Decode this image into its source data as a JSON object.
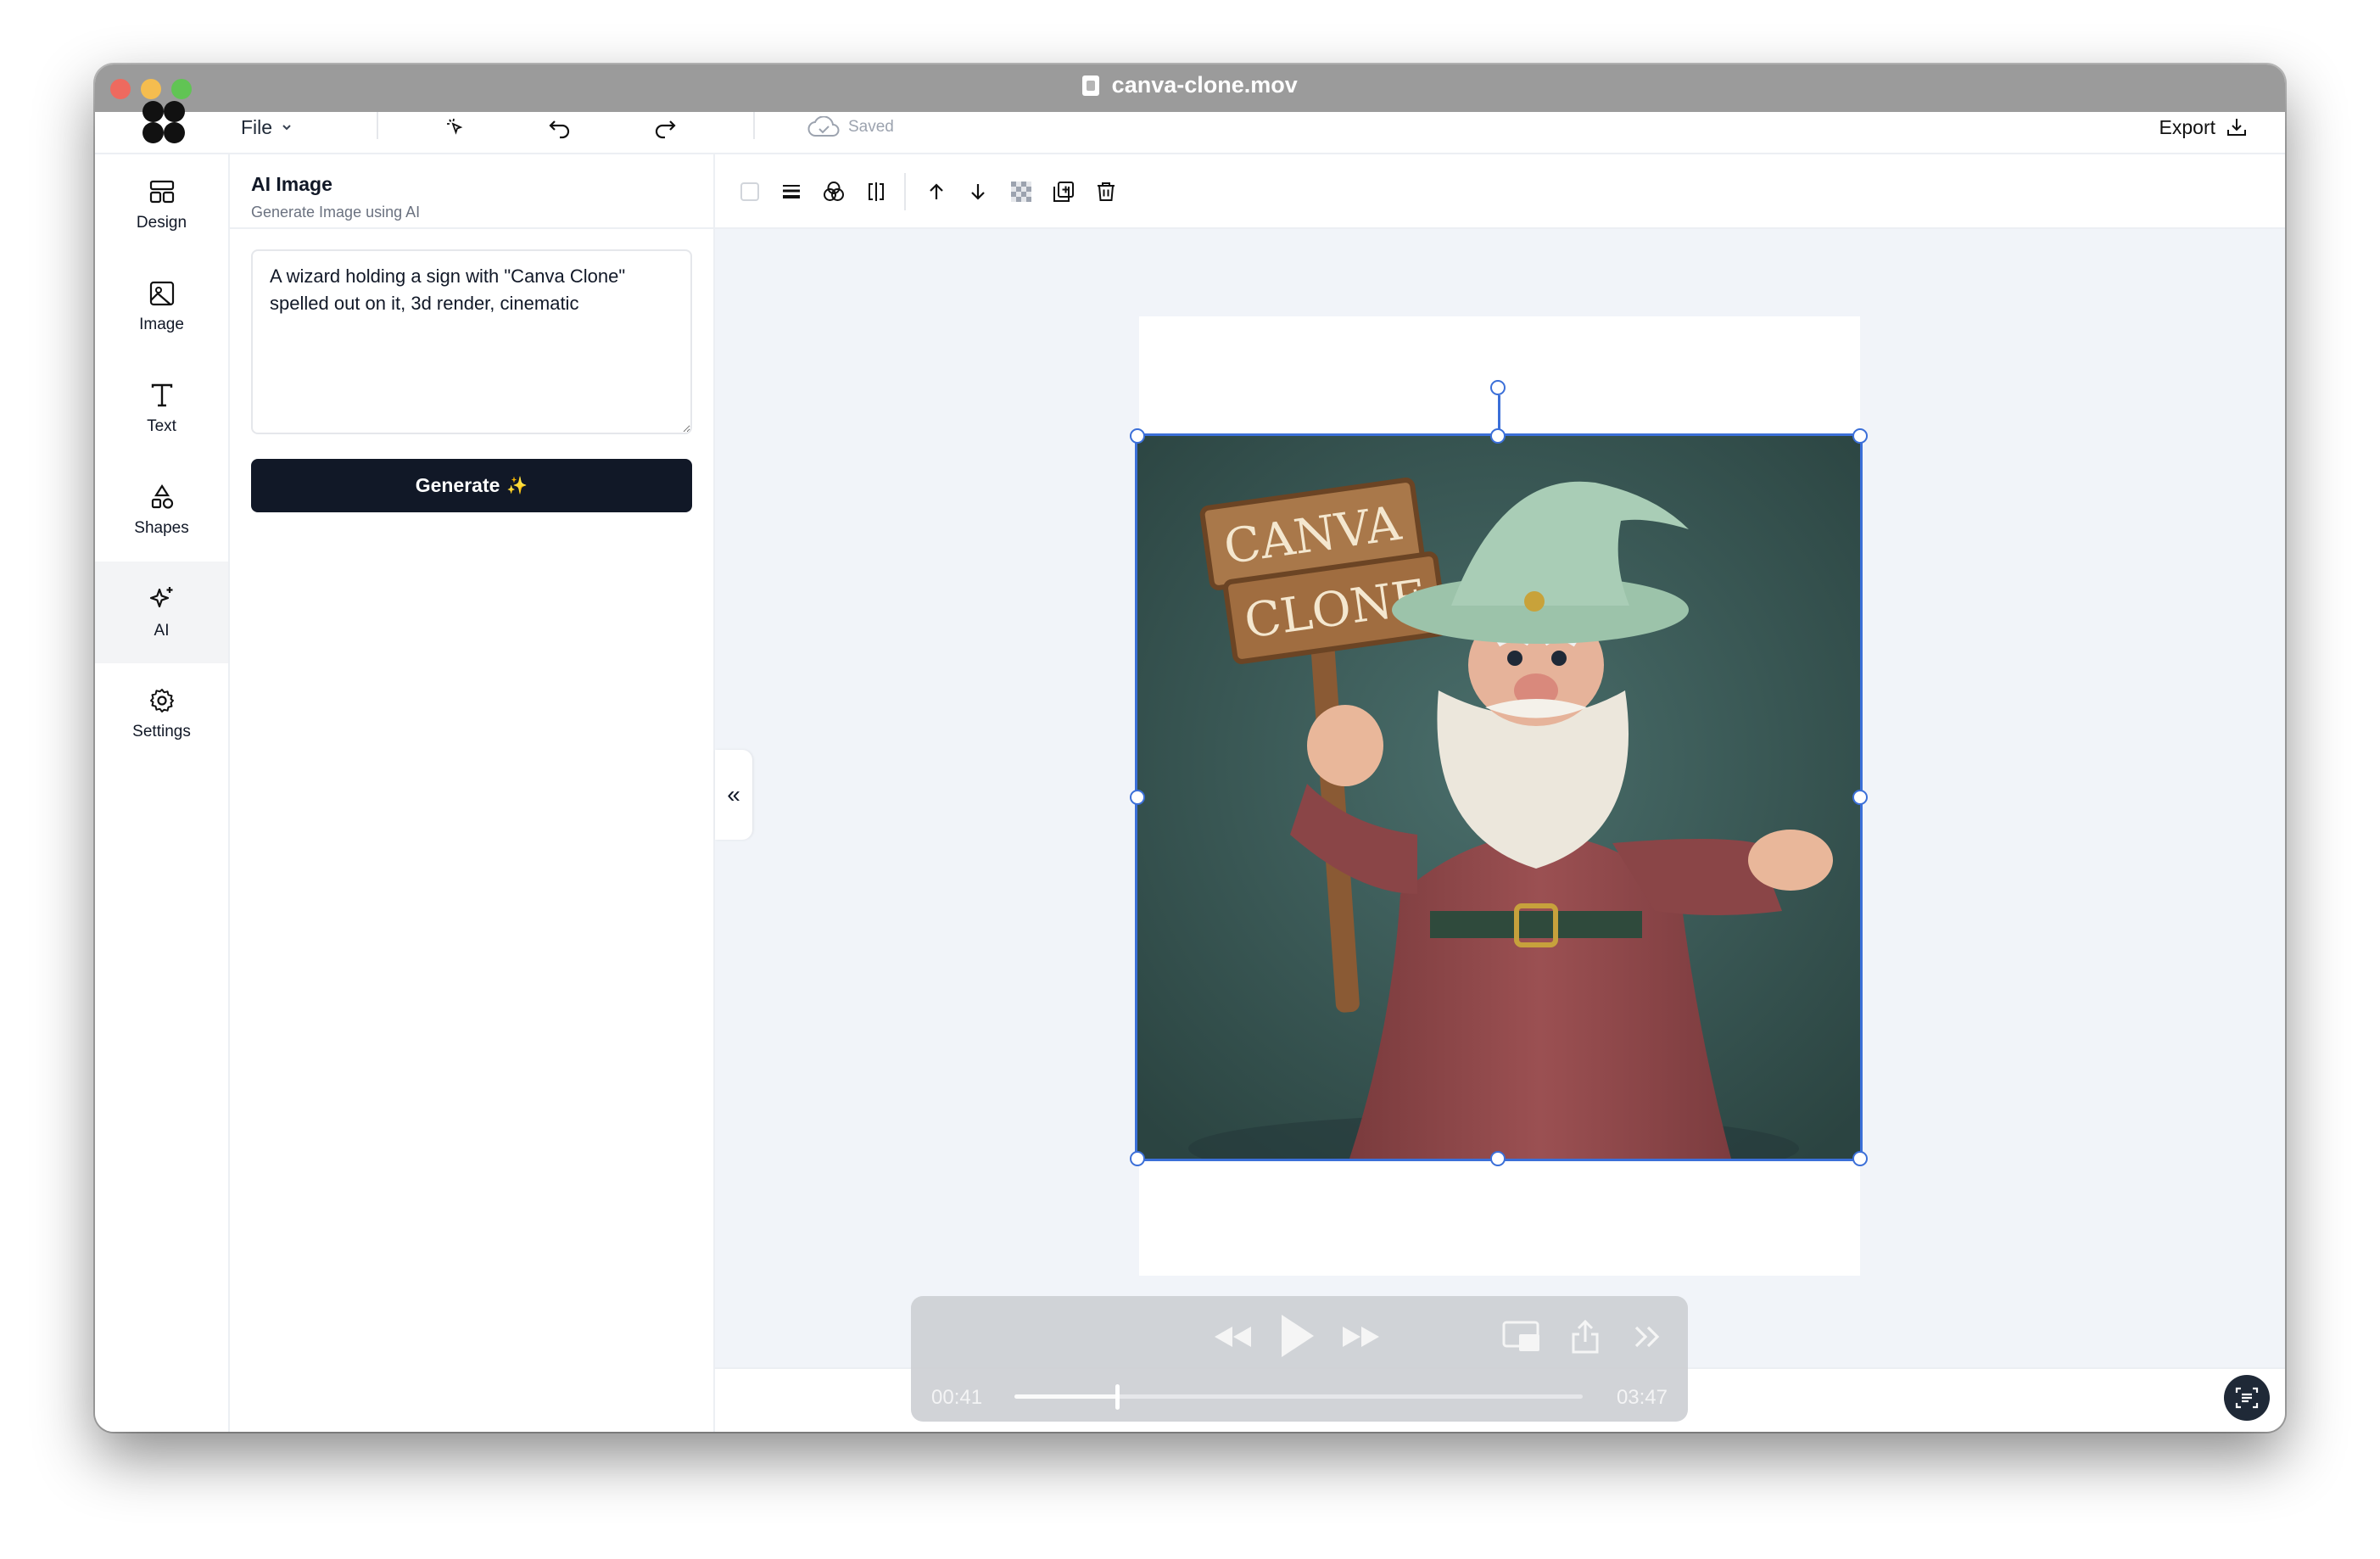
{
  "window": {
    "title": "canva-clone.mov"
  },
  "header": {
    "file_label": "File",
    "saved_label": "Saved",
    "export_label": "Export"
  },
  "rail": {
    "items": [
      {
        "label": "Design",
        "icon": "layout-icon"
      },
      {
        "label": "Image",
        "icon": "image-icon"
      },
      {
        "label": "Text",
        "icon": "text-icon"
      },
      {
        "label": "Shapes",
        "icon": "shapes-icon"
      },
      {
        "label": "AI",
        "icon": "sparkles-icon",
        "active": true
      },
      {
        "label": "Settings",
        "icon": "gear-icon"
      }
    ]
  },
  "panel": {
    "title": "AI Image",
    "subtitle": "Generate Image using AI",
    "prompt_value": "A wizard holding a sign with \"Canva Clone\" spelled out on it, 3d render, cinematic",
    "generate_label": "Generate",
    "generate_emoji": "✨"
  },
  "canvas": {
    "image_alt": "3D wizard holding a wooden sign",
    "sign_line1": "CANVA",
    "sign_line2": "CLONE"
  },
  "player": {
    "current_time": "00:41",
    "total_time": "03:47",
    "progress": 0.18
  },
  "colors": {
    "selection": "#3b6fd8",
    "generate_bg": "#111827",
    "canvas_bg": "#f1f4f9"
  }
}
